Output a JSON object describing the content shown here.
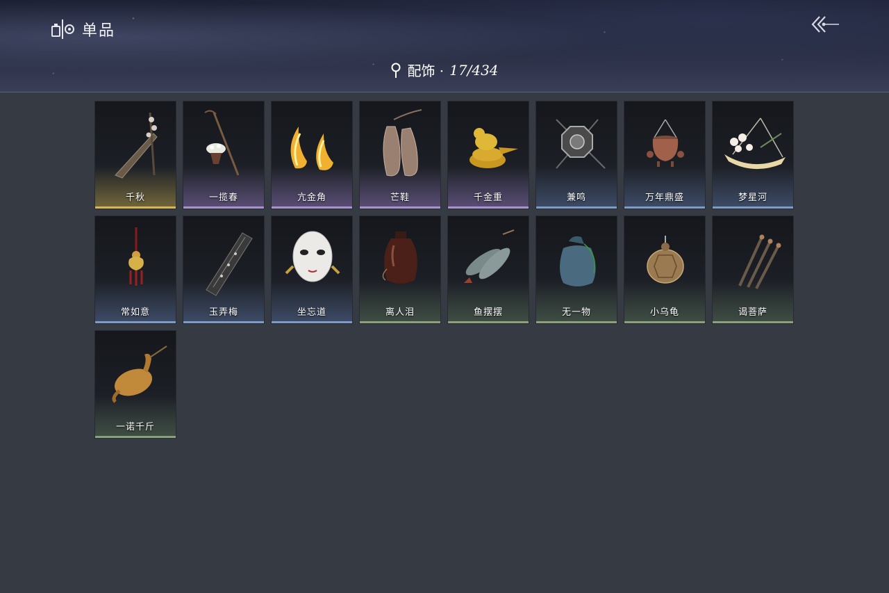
{
  "header": {
    "title": "单品",
    "title_icon": "wardrobe-icon",
    "back_icon": "double-chevron-left-icon",
    "category_icon": "location-pin-icon",
    "category": "配饰 · ",
    "count": "17/434"
  },
  "rarity_colors": {
    "gold": "#d6b65a",
    "purple": "#a993cc",
    "blue": "#7d9bc6",
    "green": "#8aa27c"
  },
  "items": [
    {
      "name": "千秋",
      "rarity": "gold",
      "icon": "guqin-with-flowers-icon"
    },
    {
      "name": "一揽春",
      "rarity": "purple",
      "icon": "flower-basket-staff-icon"
    },
    {
      "name": "亢金角",
      "rarity": "purple",
      "icon": "golden-horns-icon"
    },
    {
      "name": "芒鞋",
      "rarity": "purple",
      "icon": "straw-sandals-icon"
    },
    {
      "name": "千金重",
      "rarity": "purple",
      "icon": "golden-bird-icon"
    },
    {
      "name": "兼鸣",
      "rarity": "blue",
      "icon": "octagonal-ornament-icon"
    },
    {
      "name": "万年鼎盛",
      "rarity": "blue",
      "icon": "hanging-censer-icon"
    },
    {
      "name": "梦星河",
      "rarity": "blue",
      "icon": "flower-boat-icon"
    },
    {
      "name": "常如意",
      "rarity": "blue",
      "icon": "golden-pendant-icon"
    },
    {
      "name": "玉弄梅",
      "rarity": "blue",
      "icon": "flute-case-icon"
    },
    {
      "name": "坐忘道",
      "rarity": "blue",
      "icon": "white-mask-icon"
    },
    {
      "name": "离人泪",
      "rarity": "green",
      "icon": "wine-jar-icon"
    },
    {
      "name": "鱼摆摆",
      "rarity": "green",
      "icon": "fish-bundle-icon"
    },
    {
      "name": "无一物",
      "rarity": "green",
      "icon": "cloth-sack-icon"
    },
    {
      "name": "小乌龟",
      "rarity": "green",
      "icon": "tortoise-icon"
    },
    {
      "name": "谒菩萨",
      "rarity": "green",
      "icon": "incense-sticks-icon"
    },
    {
      "name": "一诺千斤",
      "rarity": "green",
      "icon": "roast-chicken-icon"
    }
  ]
}
